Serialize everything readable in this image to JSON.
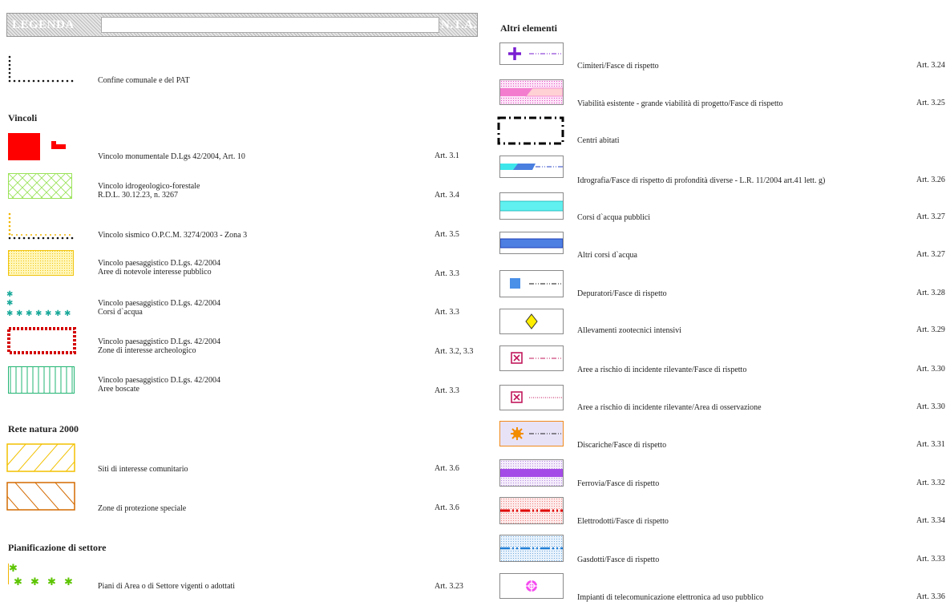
{
  "header": {
    "legend_label": "LEGENDA",
    "nta_label": "N.T.A."
  },
  "left": {
    "boundary": {
      "label": "Confine comunale e del PAT"
    },
    "vincoli": {
      "title": "Vincoli",
      "items": [
        {
          "lines": [
            "Vincolo monumentale D.Lgs 42/2004, Art. 10"
          ],
          "art": "Art. 3.1",
          "icon": "red-block-icon"
        },
        {
          "lines": [
            "Vincolo idrogeologico-forestale",
            "R.D.L. 30.12.23, n. 3267"
          ],
          "art": "Art. 3.4",
          "icon": "green-crosshatch-icon"
        },
        {
          "lines": [
            "Vincolo sismico O.P.C.M. 3274/2003 - Zona 3"
          ],
          "art": "Art. 3.5",
          "icon": "dotted-corner-icon"
        },
        {
          "lines": [
            "Vincolo paesaggistico D.Lgs. 42/2004",
            "Aree di notevole interesse pubblico"
          ],
          "art": "Art. 3.3",
          "icon": "yellow-dots-icon"
        },
        {
          "lines": [
            "Vincolo paesaggistico D.Lgs. 42/2004",
            "Corsi d`acqua"
          ],
          "art": "Art. 3.3",
          "icon": "teal-stars-icon"
        },
        {
          "lines": [
            "Vincolo paesaggistico D.Lgs. 42/2004",
            "Zone di interesse archeologico"
          ],
          "art": "Art. 3.2, 3.3",
          "icon": "red-diamond-border-icon"
        },
        {
          "lines": [
            "Vincolo paesaggistico D.Lgs. 42/2004",
            "Aree boscate"
          ],
          "art": "Art. 3.3",
          "icon": "green-vertical-lines-icon"
        }
      ]
    },
    "natura": {
      "title": "Rete natura 2000",
      "items": [
        {
          "label": "Siti di interesse comunitario",
          "art": "Art. 3.6",
          "icon": "yellow-hatch-icon"
        },
        {
          "label": "Zone di protezione speciale",
          "art": "Art. 3.6",
          "icon": "orange-hatch-icon"
        }
      ]
    },
    "settore": {
      "title": "Pianificazione di settore",
      "items": [
        {
          "label": "Piani di Area o di Settore vigenti o adottati",
          "art": "Art. 3.23",
          "icon": "green-stars-icon"
        }
      ]
    }
  },
  "right": {
    "title": "Altri elementi",
    "items": [
      {
        "label": "Cimiteri/Fasce di rispetto",
        "art": "Art. 3.24",
        "icon": "cross-icon"
      },
      {
        "label": "Viabilità esistente - grande viabilità di progetto/Fasce di rispetto",
        "art": "Art. 3.25",
        "icon": "road-icon"
      },
      {
        "label": "Centri abitati",
        "art": "",
        "icon": "dashdot-rect-icon"
      },
      {
        "label": "Idrografia/Fasce di rispetto di profondità diverse - L.R. 11/2004 art.41 lett. g)",
        "art": "Art. 3.26",
        "icon": "hydro-icon"
      },
      {
        "label": "Corsi d`acqua pubblici",
        "art": "Art. 3.27",
        "icon": "cyan-band-icon"
      },
      {
        "label": "Altri corsi d`acqua",
        "art": "Art. 3.27",
        "icon": "blue-band-icon"
      },
      {
        "label": "Depuratori/Fasce di rispetto",
        "art": "Art. 3.28",
        "icon": "blue-square-icon"
      },
      {
        "label": "Allevamenti zootecnici intensivi",
        "art": "Art. 3.29",
        "icon": "yellow-diamond-icon"
      },
      {
        "label": "Aree a rischio di incidente rilevante/Fasce di rispetto",
        "art": "Art. 3.30",
        "icon": "boxed-x-icon"
      },
      {
        "label": "Aree a rischio di incidente rilevante/Area di osservazione",
        "art": "Art. 3.30",
        "icon": "boxed-x-dotted-icon"
      },
      {
        "label": "Discariche/Fasce di rispetto",
        "art": "Art. 3.31",
        "icon": "orange-gear-icon"
      },
      {
        "label": "Ferrovia/Fasce di rispetto",
        "art": "Art. 3.32",
        "icon": "purple-rail-icon"
      },
      {
        "label": "Elettrodotti/Fasce di rispetto",
        "art": "Art. 3.34",
        "icon": "red-power-line-icon"
      },
      {
        "label": "Gasdotti/Fasce di rispetto",
        "art": "Art. 3.33",
        "icon": "blue-gas-line-icon"
      },
      {
        "label": "Impianti di telecomunicazione elettronica ad uso pubblico",
        "art": "Art. 3.36",
        "icon": "antenna-icon"
      }
    ]
  }
}
